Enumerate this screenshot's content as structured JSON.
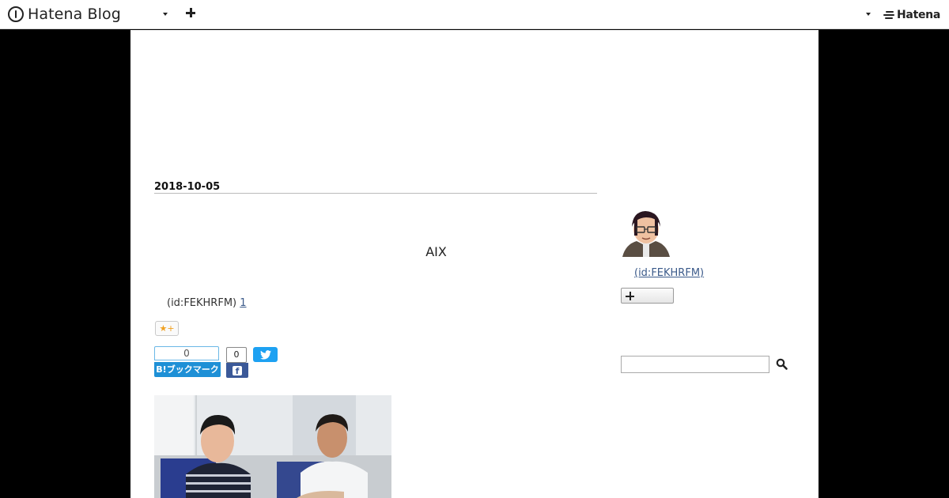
{
  "topbar": {
    "logo_text": "Hatena Blog",
    "brand_text": "Hatena",
    "icons": [
      "hatena-blog-logo-icon",
      "dropdown-arrow-icon",
      "plus-icon",
      "hatena-logo-icon"
    ]
  },
  "article": {
    "date": "2018-10-05",
    "title": "AIX",
    "byline_id": "(id:FEKHRFM)",
    "byline_link": "1"
  },
  "share": {
    "hatena_count": "0",
    "hatena_label": "B!ブックマーク",
    "facebook_count": "0",
    "facebook_label": "f"
  },
  "sidebar": {
    "profile_link": "(id:FEKHRFM)",
    "search_placeholder": ""
  },
  "colors": {
    "page_bg": "#000000",
    "content_bg": "#ffffff",
    "link": "#3b5a8a",
    "hatena_bookmark_blue": "#1e90d6",
    "facebook_blue": "#3b5998",
    "twitter_blue": "#1da1f2"
  }
}
